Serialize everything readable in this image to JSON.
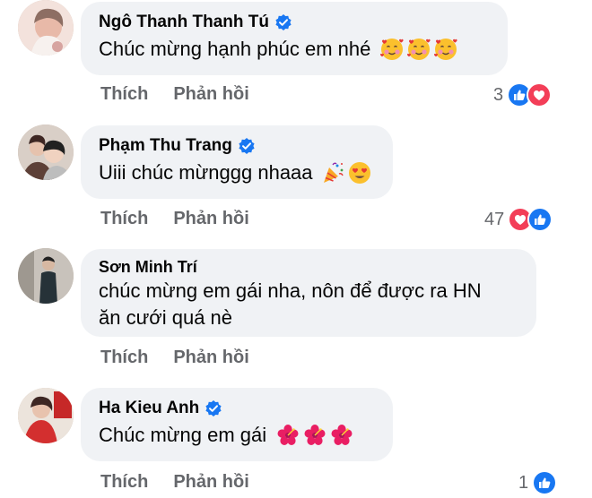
{
  "comments": [
    {
      "name": "Ngô Thanh Thanh Tú",
      "verified": true,
      "text": "Chúc mừng hạnh phúc em nhé",
      "emojis": [
        "smiling-face-with-hearts",
        "smiling-face-with-hearts",
        "smiling-face-with-hearts"
      ],
      "like_label": "Thích",
      "reply_label": "Phản hồi",
      "reaction_count": "3",
      "reactions": [
        "like",
        "love"
      ]
    },
    {
      "name": "Phạm Thu Trang",
      "verified": true,
      "text": "Uiii chúc mừnggg nhaaa",
      "emojis": [
        "party-popper",
        "heart-eyes"
      ],
      "like_label": "Thích",
      "reply_label": "Phản hồi",
      "reaction_count": "47",
      "reactions": [
        "love",
        "like"
      ]
    },
    {
      "name": "Sơn Minh Trí",
      "verified": false,
      "text_line1": "chúc mừng em gái nha, nôn để được ra HN",
      "text_line2": "ăn cưới quá nè",
      "like_label": "Thích",
      "reply_label": "Phản hồi"
    },
    {
      "name": "Ha Kieu Anh",
      "verified": true,
      "text": "Chúc mừng em gái",
      "emojis": [
        "hibiscus",
        "hibiscus",
        "hibiscus"
      ],
      "like_label": "Thích",
      "reply_label": "Phản hồi",
      "reaction_count": "1",
      "reactions": [
        "like"
      ]
    }
  ],
  "colors": {
    "bubble": "#f0f2f5",
    "verified": "#1877f2",
    "like": "#1877f2",
    "love": "#f33e58",
    "muted": "#65676b"
  }
}
